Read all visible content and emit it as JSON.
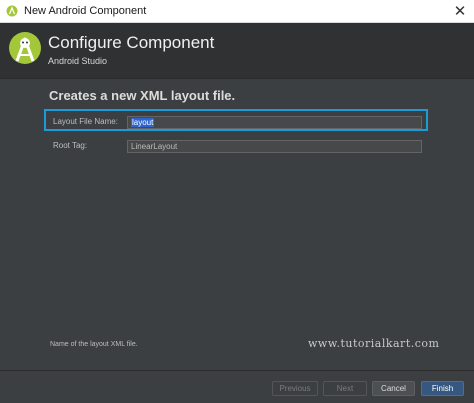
{
  "window": {
    "title": "New Android Component"
  },
  "header": {
    "title": "Configure Component",
    "subtitle": "Android Studio"
  },
  "main": {
    "heading": "Creates a new XML layout file.",
    "fields": [
      {
        "label": "Layout File Name:",
        "value": "layout"
      },
      {
        "label": "Root Tag:",
        "value": "LinearLayout"
      }
    ],
    "hint": "Name of the layout XML file.",
    "watermark": "www.tutorialkart.com"
  },
  "footer": {
    "previous_label": "Previous",
    "next_label": "Next",
    "cancel_label": "Cancel",
    "finish_label": "Finish"
  },
  "colors": {
    "highlight": "#1d9bd6",
    "android_green": "#a4c639",
    "primary_button": "#365880",
    "selection": "#2f65ca"
  },
  "icons": {
    "app": "android-studio-icon",
    "logo": "android-studio-logo",
    "close": "close-icon"
  }
}
